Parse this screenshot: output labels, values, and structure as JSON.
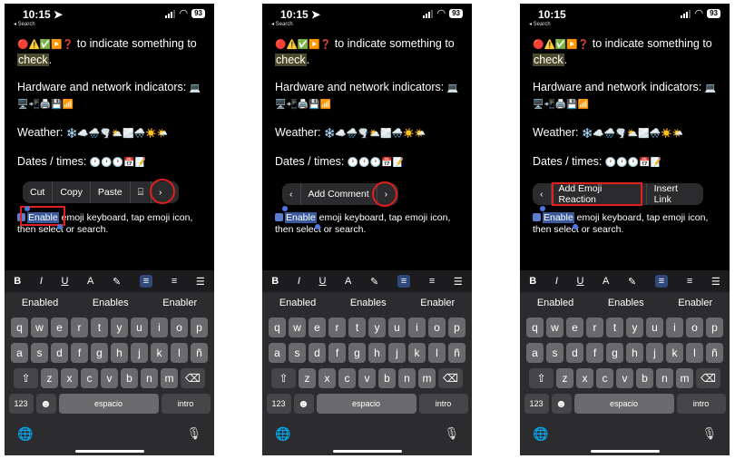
{
  "status": {
    "time_1": "10:15 ➤",
    "time_2": "10:15 ➤",
    "time_3": "10:15",
    "back": "◂ Search",
    "battery": "93"
  },
  "content": {
    "line1_emojis": "🔴⚠️✅▶️❓",
    "line1_text": " to indicate something to ",
    "line1_highlight": "check",
    "line1_end": ".",
    "hardware": "Hardware and network indicators:",
    "hardware_emojis": "💻🖥️📲🖨️💾📶",
    "weather": "Weather:",
    "weather_emojis": "❄️☁️🌧️🌪️⛅🌫️🌨️☀️🌤️",
    "dates": "Dates / times:",
    "dates_emojis": "🕐🕐🕐📅📝",
    "selected_word": "Enable",
    "edit_rest": " emoji keyboard, tap emoji icon, then select or search."
  },
  "menus": {
    "menu1": [
      "Cut",
      "Copy",
      "Paste",
      "⌸",
      "›"
    ],
    "menu2": [
      "‹",
      "Add Comment",
      "›"
    ],
    "menu3": [
      "‹",
      "Add Emoji Reaction",
      "Insert Link"
    ]
  },
  "toolbar": [
    "B",
    "I",
    "U",
    "A",
    "✎",
    "≡",
    "≡",
    "☰"
  ],
  "suggestions": [
    "Enabled",
    "Enables",
    "Enabler"
  ],
  "keyboard": {
    "row1": [
      "q",
      "w",
      "e",
      "r",
      "t",
      "y",
      "u",
      "i",
      "o",
      "p"
    ],
    "row2": [
      "a",
      "s",
      "d",
      "f",
      "g",
      "h",
      "j",
      "k",
      "l",
      "ñ"
    ],
    "row3": [
      "z",
      "x",
      "c",
      "v",
      "b",
      "n",
      "m"
    ],
    "shift": "⇧",
    "delete": "⌫",
    "num": "123",
    "emoji": "☻",
    "space": "espacio",
    "enter": "intro",
    "globe": "🌐",
    "mic": "🎙"
  }
}
